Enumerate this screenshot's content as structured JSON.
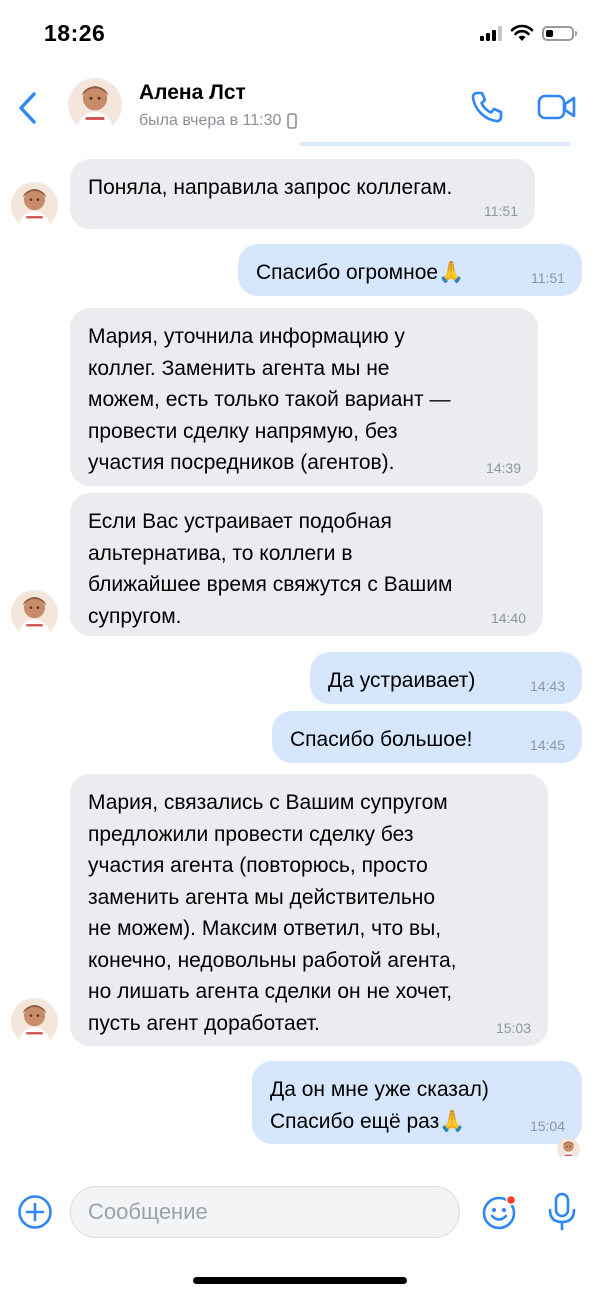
{
  "status_bar": {
    "time": "18:26"
  },
  "header": {
    "contact_name": "Алена Лст",
    "last_seen": "была вчера в 11:30"
  },
  "messages": [
    {
      "direction": "incoming",
      "text": "Поняла, направила запрос коллегам.",
      "time": "11:51"
    },
    {
      "direction": "outgoing",
      "text": "Спасибо огромное🙏",
      "time": "11:51"
    },
    {
      "direction": "incoming",
      "text": "Мария, уточнила информацию у\nколлег. Заменить агента мы не\nможем, есть только такой вариант —\nпровести сделку напрямую, без\nучастия посредников (агентов).",
      "time": "14:39"
    },
    {
      "direction": "incoming",
      "text": "Если Вас устраивает подобная\nальтернатива, то коллеги в\nближайшее время свяжутся с Вашим\nсупругом.",
      "time": "14:40"
    },
    {
      "direction": "outgoing",
      "text": "Да устраивает)",
      "time": "14:43"
    },
    {
      "direction": "outgoing",
      "text": "Спасибо большое!",
      "time": "14:45"
    },
    {
      "direction": "incoming",
      "text": "Мария, связались с Вашим супругом\nпредложили провести сделку без\nучастия агента (повторюсь, просто\nзаменить агента мы действительно\nне можем). Максим ответил, что вы,\nконечно, недовольны работой агента,\nно лишать агента сделки он не хочет,\nпусть агент доработает.",
      "time": "15:03"
    },
    {
      "direction": "outgoing",
      "text": "Да он мне уже сказал)\nСпасибо ещё раз🙏",
      "time": "15:04"
    }
  ],
  "composer": {
    "placeholder": "Сообщение"
  },
  "colors": {
    "accent": "#2f86f6",
    "incoming_bubble": "#eaecf0",
    "outgoing_bubble": "#d5e6fd",
    "muted_text": "#8d96a3",
    "unread_dot": "#ff3b30"
  }
}
